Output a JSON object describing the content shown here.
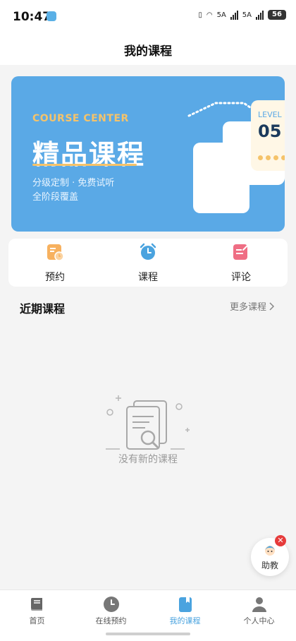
{
  "status": {
    "time": "10:47",
    "net1": "5A",
    "net2": "5A",
    "battery": "56"
  },
  "header": {
    "title": "我的课程"
  },
  "banner": {
    "en_title": "COURSE CENTER",
    "title": "精品课程",
    "sub1": "分级定制 · 免费试听",
    "sub2": "全阶段覆盖",
    "level_label": "LEVEL",
    "level_num": "05",
    "colors": {
      "bg": "#5aa9e6",
      "accent": "#f5c36a"
    }
  },
  "quick_actions": [
    {
      "label": "预约",
      "icon": "calendar-clock-icon",
      "color": "#f7b15f"
    },
    {
      "label": "课程",
      "icon": "alarm-clock-icon",
      "color": "#4aa3df"
    },
    {
      "label": "评论",
      "icon": "edit-note-icon",
      "color": "#ef6e84"
    }
  ],
  "recent": {
    "title": "近期课程",
    "more": "更多课程",
    "empty_text": "没有新的课程"
  },
  "assistant": {
    "label": "助教",
    "close": "✕"
  },
  "tabs": [
    {
      "label": "首页",
      "icon": "book-icon",
      "active": false
    },
    {
      "label": "在线预约",
      "icon": "clock-icon",
      "active": false
    },
    {
      "label": "我的课程",
      "icon": "bookmark-book-icon",
      "active": true
    },
    {
      "label": "个人中心",
      "icon": "person-icon",
      "active": false
    }
  ]
}
